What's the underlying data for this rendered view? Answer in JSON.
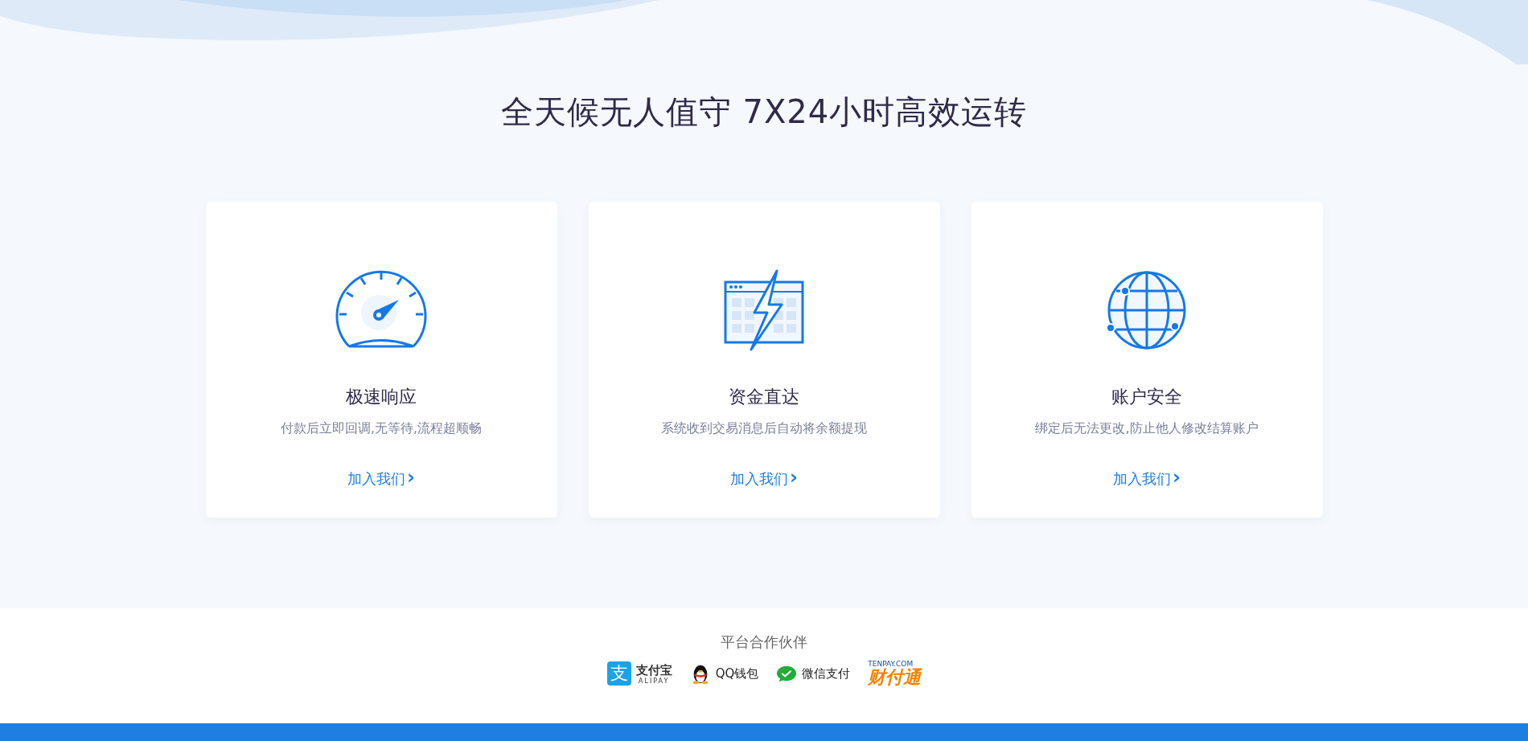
{
  "headline": "全天候无人值守 7X24小时高效运转",
  "features": [
    {
      "kind": "speed",
      "title": "极速响应",
      "description": "付款后立即回调,无等待,流程超顺畅",
      "link": "加入我们",
      "link_arrow": "›"
    },
    {
      "kind": "funds",
      "title": "资金直达",
      "description": "系统收到交易消息后自动将余额提现",
      "link": "加入我们",
      "link_arrow": "›"
    },
    {
      "kind": "security",
      "title": "账户安全",
      "description": "绑定后无法更改,防止他人修改结算账户",
      "link": "加入我们",
      "link_arrow": "›"
    }
  ],
  "partners": {
    "title": "平台合作伙伴",
    "logos": [
      {
        "kind": "alipay",
        "glyph": "支",
        "name": "支付宝",
        "subtitle": "ALIPAY"
      },
      {
        "kind": "qq",
        "name": "QQ钱包"
      },
      {
        "kind": "wechat",
        "name": "微信支付"
      },
      {
        "kind": "tenpay",
        "name": "财付通",
        "subtitle": "TENPAY.COM"
      }
    ]
  }
}
